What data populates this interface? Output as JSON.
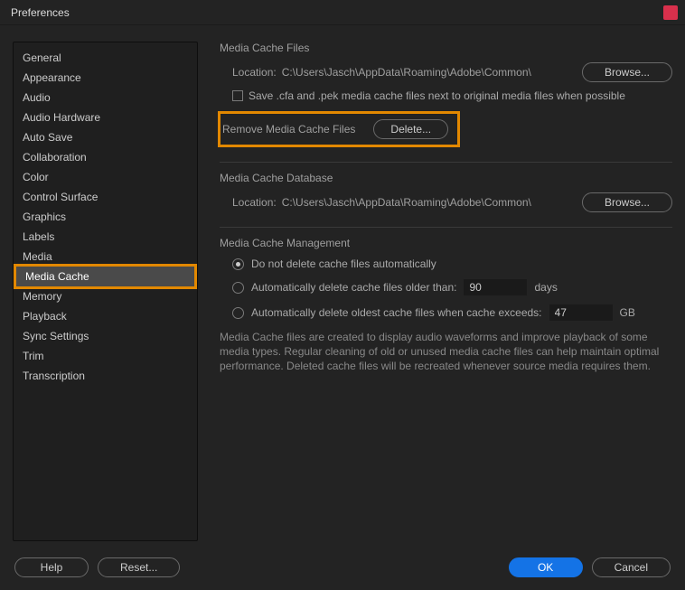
{
  "window": {
    "title": "Preferences"
  },
  "sidebar": {
    "items": [
      "General",
      "Appearance",
      "Audio",
      "Audio Hardware",
      "Auto Save",
      "Collaboration",
      "Color",
      "Control Surface",
      "Graphics",
      "Labels",
      "Media",
      "Media Cache",
      "Memory",
      "Playback",
      "Sync Settings",
      "Trim",
      "Transcription"
    ],
    "selected_index": 11
  },
  "cache_files": {
    "title": "Media Cache Files",
    "location_label": "Location:",
    "location_value": "C:\\Users\\Jasch\\AppData\\Roaming\\Adobe\\Common\\",
    "browse_label": "Browse...",
    "save_checkbox_label": "Save .cfa and .pek media cache files next to original media files when possible",
    "remove_label": "Remove Media Cache Files",
    "delete_label": "Delete..."
  },
  "cache_db": {
    "title": "Media Cache Database",
    "location_label": "Location:",
    "location_value": "C:\\Users\\Jasch\\AppData\\Roaming\\Adobe\\Common\\",
    "browse_label": "Browse..."
  },
  "cache_mgmt": {
    "title": "Media Cache Management",
    "opt_no_delete": "Do not delete cache files automatically",
    "opt_older_than": "Automatically delete cache files older than:",
    "days_value": "90",
    "days_unit": "days",
    "opt_exceeds": "Automatically delete oldest cache files when cache exceeds:",
    "gb_value": "47",
    "gb_unit": "GB",
    "description": "Media Cache files are created to display audio waveforms and improve playback of some media types.  Regular cleaning of old or unused media cache files can help maintain optimal performance. Deleted cache files will be recreated whenever source media requires them."
  },
  "buttons": {
    "help": "Help",
    "reset": "Reset...",
    "ok": "OK",
    "cancel": "Cancel"
  }
}
